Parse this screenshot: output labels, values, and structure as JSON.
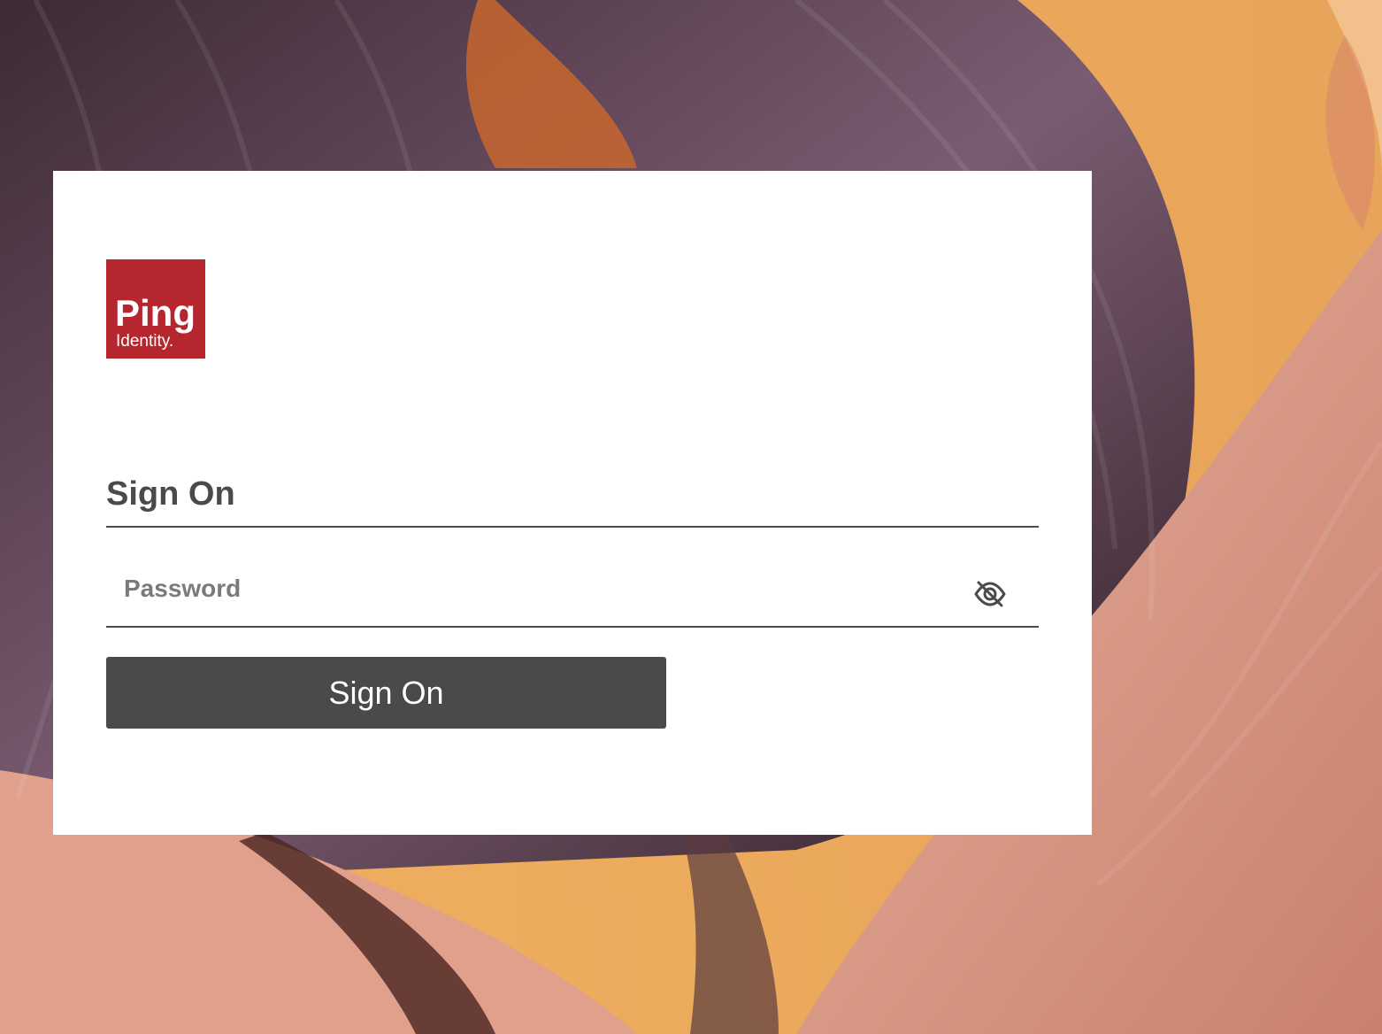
{
  "brand": {
    "logo_word": "Ping",
    "logo_sub": "Identity.",
    "logo_color": "#b5262f"
  },
  "form": {
    "heading": "Sign On",
    "password_placeholder": "Password",
    "password_value": "",
    "visibility_icon": "eye-slash-icon",
    "submit_label": "Sign On",
    "button_color": "#4a4a4a"
  }
}
